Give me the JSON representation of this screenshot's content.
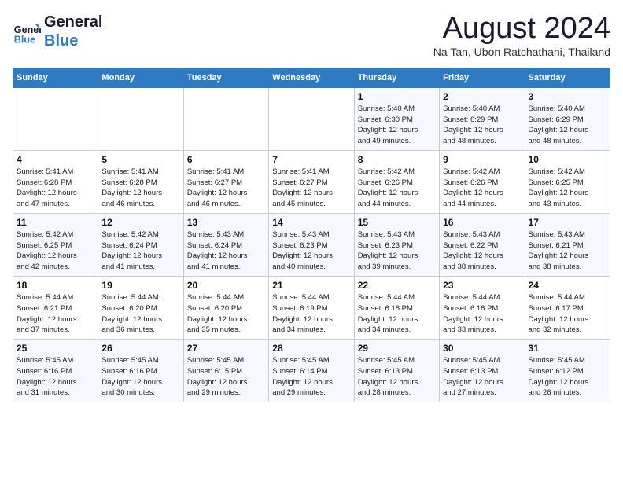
{
  "header": {
    "logo_line1": "General",
    "logo_line2": "Blue",
    "month_title": "August 2024",
    "location": "Na Tan, Ubon Ratchathani, Thailand"
  },
  "weekdays": [
    "Sunday",
    "Monday",
    "Tuesday",
    "Wednesday",
    "Thursday",
    "Friday",
    "Saturday"
  ],
  "weeks": [
    [
      {
        "day": "",
        "info": ""
      },
      {
        "day": "",
        "info": ""
      },
      {
        "day": "",
        "info": ""
      },
      {
        "day": "",
        "info": ""
      },
      {
        "day": "1",
        "info": "Sunrise: 5:40 AM\nSunset: 6:30 PM\nDaylight: 12 hours\nand 49 minutes."
      },
      {
        "day": "2",
        "info": "Sunrise: 5:40 AM\nSunset: 6:29 PM\nDaylight: 12 hours\nand 48 minutes."
      },
      {
        "day": "3",
        "info": "Sunrise: 5:40 AM\nSunset: 6:29 PM\nDaylight: 12 hours\nand 48 minutes."
      }
    ],
    [
      {
        "day": "4",
        "info": "Sunrise: 5:41 AM\nSunset: 6:28 PM\nDaylight: 12 hours\nand 47 minutes."
      },
      {
        "day": "5",
        "info": "Sunrise: 5:41 AM\nSunset: 6:28 PM\nDaylight: 12 hours\nand 46 minutes."
      },
      {
        "day": "6",
        "info": "Sunrise: 5:41 AM\nSunset: 6:27 PM\nDaylight: 12 hours\nand 46 minutes."
      },
      {
        "day": "7",
        "info": "Sunrise: 5:41 AM\nSunset: 6:27 PM\nDaylight: 12 hours\nand 45 minutes."
      },
      {
        "day": "8",
        "info": "Sunrise: 5:42 AM\nSunset: 6:26 PM\nDaylight: 12 hours\nand 44 minutes."
      },
      {
        "day": "9",
        "info": "Sunrise: 5:42 AM\nSunset: 6:26 PM\nDaylight: 12 hours\nand 44 minutes."
      },
      {
        "day": "10",
        "info": "Sunrise: 5:42 AM\nSunset: 6:25 PM\nDaylight: 12 hours\nand 43 minutes."
      }
    ],
    [
      {
        "day": "11",
        "info": "Sunrise: 5:42 AM\nSunset: 6:25 PM\nDaylight: 12 hours\nand 42 minutes."
      },
      {
        "day": "12",
        "info": "Sunrise: 5:42 AM\nSunset: 6:24 PM\nDaylight: 12 hours\nand 41 minutes."
      },
      {
        "day": "13",
        "info": "Sunrise: 5:43 AM\nSunset: 6:24 PM\nDaylight: 12 hours\nand 41 minutes."
      },
      {
        "day": "14",
        "info": "Sunrise: 5:43 AM\nSunset: 6:23 PM\nDaylight: 12 hours\nand 40 minutes."
      },
      {
        "day": "15",
        "info": "Sunrise: 5:43 AM\nSunset: 6:23 PM\nDaylight: 12 hours\nand 39 minutes."
      },
      {
        "day": "16",
        "info": "Sunrise: 5:43 AM\nSunset: 6:22 PM\nDaylight: 12 hours\nand 38 minutes."
      },
      {
        "day": "17",
        "info": "Sunrise: 5:43 AM\nSunset: 6:21 PM\nDaylight: 12 hours\nand 38 minutes."
      }
    ],
    [
      {
        "day": "18",
        "info": "Sunrise: 5:44 AM\nSunset: 6:21 PM\nDaylight: 12 hours\nand 37 minutes."
      },
      {
        "day": "19",
        "info": "Sunrise: 5:44 AM\nSunset: 6:20 PM\nDaylight: 12 hours\nand 36 minutes."
      },
      {
        "day": "20",
        "info": "Sunrise: 5:44 AM\nSunset: 6:20 PM\nDaylight: 12 hours\nand 35 minutes."
      },
      {
        "day": "21",
        "info": "Sunrise: 5:44 AM\nSunset: 6:19 PM\nDaylight: 12 hours\nand 34 minutes."
      },
      {
        "day": "22",
        "info": "Sunrise: 5:44 AM\nSunset: 6:18 PM\nDaylight: 12 hours\nand 34 minutes."
      },
      {
        "day": "23",
        "info": "Sunrise: 5:44 AM\nSunset: 6:18 PM\nDaylight: 12 hours\nand 33 minutes."
      },
      {
        "day": "24",
        "info": "Sunrise: 5:44 AM\nSunset: 6:17 PM\nDaylight: 12 hours\nand 32 minutes."
      }
    ],
    [
      {
        "day": "25",
        "info": "Sunrise: 5:45 AM\nSunset: 6:16 PM\nDaylight: 12 hours\nand 31 minutes."
      },
      {
        "day": "26",
        "info": "Sunrise: 5:45 AM\nSunset: 6:16 PM\nDaylight: 12 hours\nand 30 minutes."
      },
      {
        "day": "27",
        "info": "Sunrise: 5:45 AM\nSunset: 6:15 PM\nDaylight: 12 hours\nand 29 minutes."
      },
      {
        "day": "28",
        "info": "Sunrise: 5:45 AM\nSunset: 6:14 PM\nDaylight: 12 hours\nand 29 minutes."
      },
      {
        "day": "29",
        "info": "Sunrise: 5:45 AM\nSunset: 6:13 PM\nDaylight: 12 hours\nand 28 minutes."
      },
      {
        "day": "30",
        "info": "Sunrise: 5:45 AM\nSunset: 6:13 PM\nDaylight: 12 hours\nand 27 minutes."
      },
      {
        "day": "31",
        "info": "Sunrise: 5:45 AM\nSunset: 6:12 PM\nDaylight: 12 hours\nand 26 minutes."
      }
    ]
  ]
}
